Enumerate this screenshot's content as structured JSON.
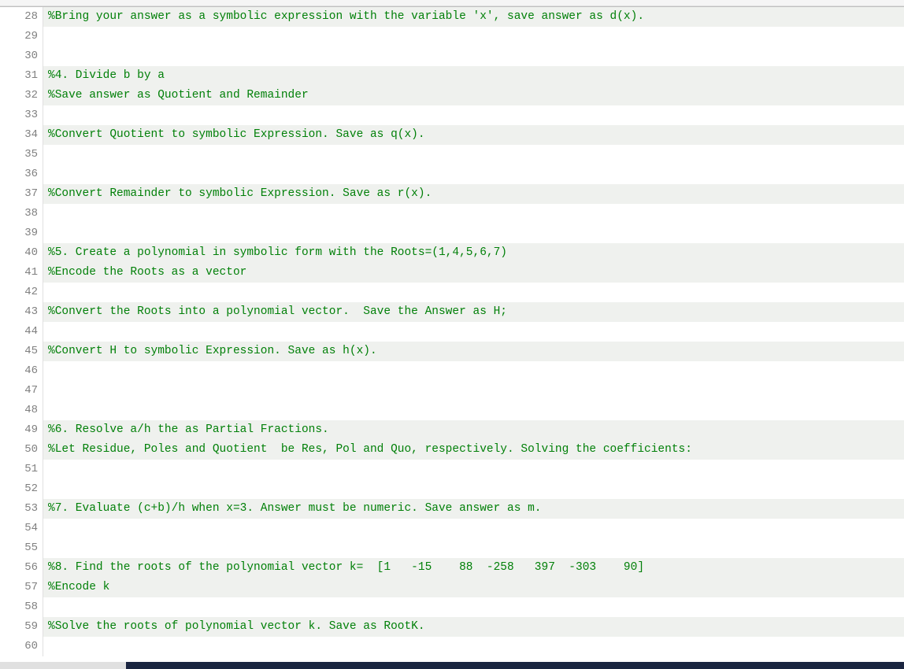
{
  "editor": {
    "lines": [
      {
        "n": 28,
        "text": "%Bring your answer as a symbolic expression with the variable 'x', save answer as d(x).",
        "cls": "comment",
        "zebra": true
      },
      {
        "n": 29,
        "text": "",
        "cls": "",
        "zebra": false
      },
      {
        "n": 30,
        "text": "",
        "cls": "",
        "zebra": false
      },
      {
        "n": 31,
        "text": "%4. Divide b by a",
        "cls": "comment",
        "zebra": true
      },
      {
        "n": 32,
        "text": "%Save answer as Quotient and Remainder",
        "cls": "comment",
        "zebra": true
      },
      {
        "n": 33,
        "text": "",
        "cls": "",
        "zebra": false
      },
      {
        "n": 34,
        "text": "%Convert Quotient to symbolic Expression. Save as q(x).",
        "cls": "comment",
        "zebra": true
      },
      {
        "n": 35,
        "text": "",
        "cls": "",
        "zebra": false
      },
      {
        "n": 36,
        "text": "",
        "cls": "",
        "zebra": false
      },
      {
        "n": 37,
        "text": "%Convert Remainder to symbolic Expression. Save as r(x).",
        "cls": "comment",
        "zebra": true
      },
      {
        "n": 38,
        "text": "",
        "cls": "",
        "zebra": false
      },
      {
        "n": 39,
        "text": "",
        "cls": "",
        "zebra": false
      },
      {
        "n": 40,
        "text": "%5. Create a polynomial in symbolic form with the Roots=(1,4,5,6,7)",
        "cls": "comment",
        "zebra": true
      },
      {
        "n": 41,
        "text": "%Encode the Roots as a vector",
        "cls": "comment",
        "zebra": true
      },
      {
        "n": 42,
        "text": "",
        "cls": "",
        "zebra": false
      },
      {
        "n": 43,
        "text": "%Convert the Roots into a polynomial vector.  Save the Answer as H;",
        "cls": "comment",
        "zebra": true
      },
      {
        "n": 44,
        "text": "",
        "cls": "",
        "zebra": false
      },
      {
        "n": 45,
        "text": "%Convert H to symbolic Expression. Save as h(x).",
        "cls": "comment",
        "zebra": true
      },
      {
        "n": 46,
        "text": "",
        "cls": "",
        "zebra": false
      },
      {
        "n": 47,
        "text": "",
        "cls": "",
        "zebra": false
      },
      {
        "n": 48,
        "text": "",
        "cls": "",
        "zebra": false
      },
      {
        "n": 49,
        "text": "%6. Resolve a/h the as Partial Fractions.",
        "cls": "comment",
        "zebra": true
      },
      {
        "n": 50,
        "text": "%Let Residue, Poles and Quotient  be Res, Pol and Quo, respectively. Solving the coefficients:",
        "cls": "comment",
        "zebra": true
      },
      {
        "n": 51,
        "text": "",
        "cls": "",
        "zebra": false
      },
      {
        "n": 52,
        "text": "",
        "cls": "",
        "zebra": false
      },
      {
        "n": 53,
        "text": "%7. Evaluate (c+b)/h when x=3. Answer must be numeric. Save answer as m.",
        "cls": "comment",
        "zebra": true
      },
      {
        "n": 54,
        "text": "",
        "cls": "",
        "zebra": false
      },
      {
        "n": 55,
        "text": "",
        "cls": "",
        "zebra": false
      },
      {
        "n": 56,
        "text": "%8. Find the roots of the polynomial vector k=  [1   -15    88  -258   397  -303    90]",
        "cls": "comment",
        "zebra": true
      },
      {
        "n": 57,
        "text": "%Encode k",
        "cls": "comment",
        "zebra": true
      },
      {
        "n": 58,
        "text": "",
        "cls": "",
        "zebra": false
      },
      {
        "n": 59,
        "text": "%Solve the roots of polynomial vector k. Save as RootK.",
        "cls": "comment",
        "zebra": true
      },
      {
        "n": 60,
        "text": "",
        "cls": "",
        "zebra": false
      }
    ]
  }
}
